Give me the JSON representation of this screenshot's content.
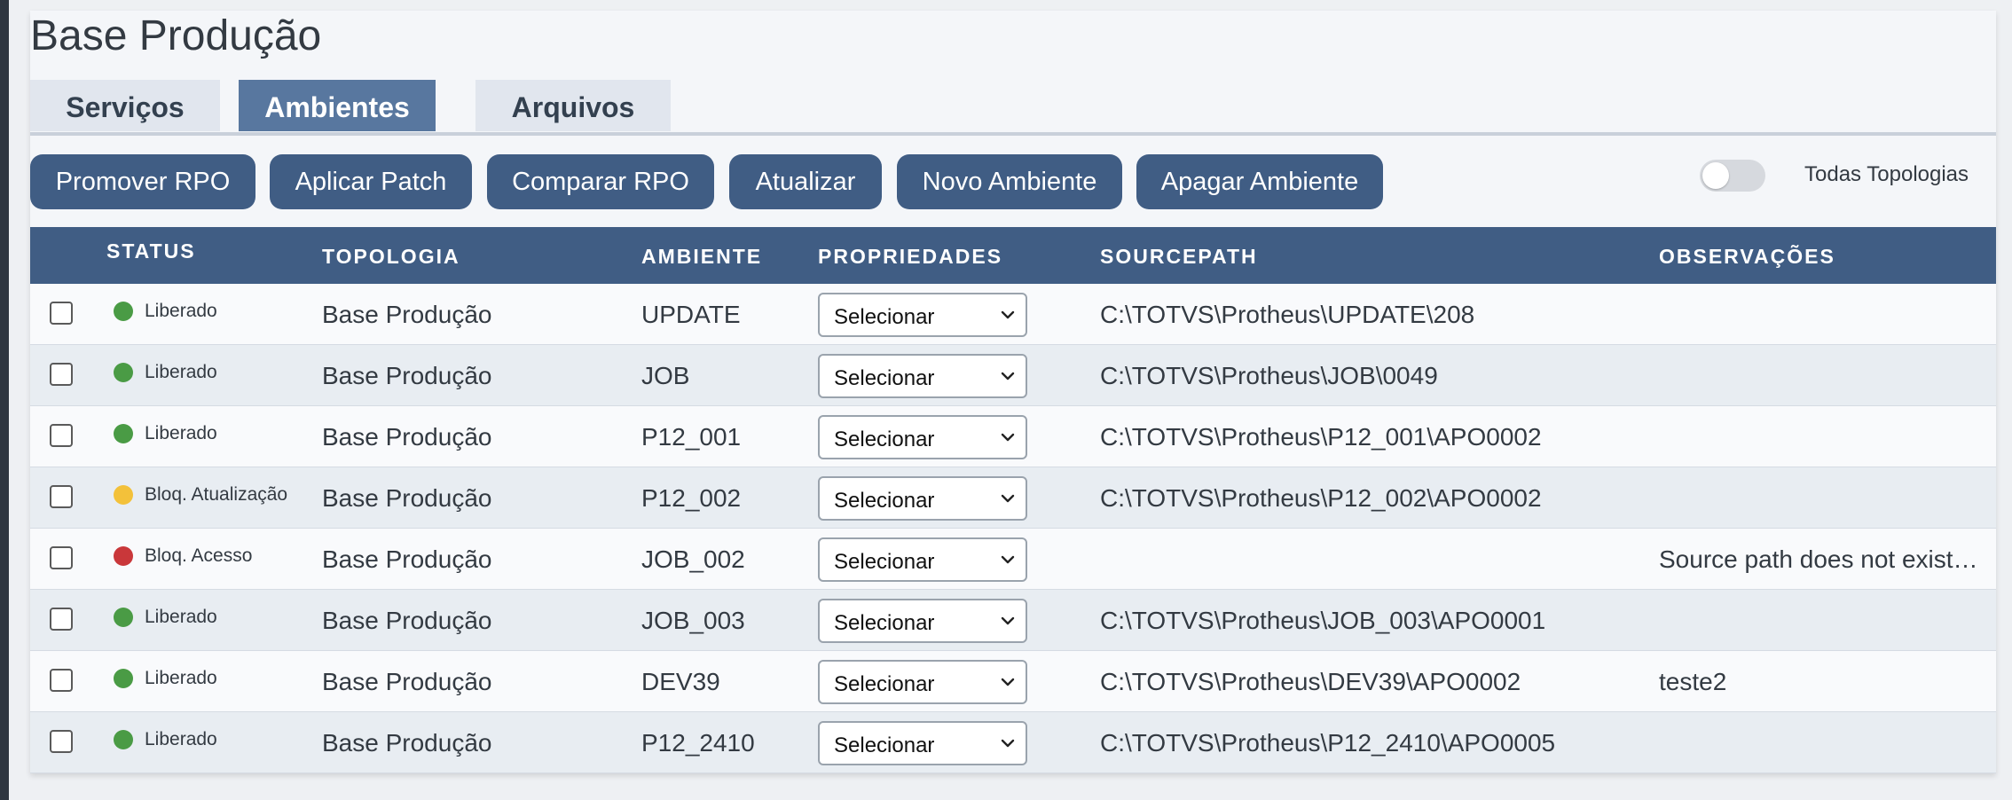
{
  "page": {
    "title": "Base Produção"
  },
  "tabs": [
    {
      "label": "Serviços",
      "active": false
    },
    {
      "label": "Ambientes",
      "active": true
    },
    {
      "label": "Arquivos",
      "active": false
    }
  ],
  "toolbar": {
    "buttons": [
      "Promover RPO",
      "Aplicar Patch",
      "Comparar RPO",
      "Atualizar",
      "Novo Ambiente",
      "Apagar Ambiente"
    ],
    "toggle_label": "Todas Topologias",
    "toggle_on": false
  },
  "table": {
    "headers": [
      "STATUS",
      "TOPOLOGIA",
      "AMBIENTE",
      "PROPRIEDADES",
      "SOURCEPATH",
      "OBSERVAÇÕES"
    ],
    "rows": [
      {
        "status": "Liberado",
        "status_color": "#4a9b45",
        "topologia": "Base Produção",
        "ambiente": "UPDATE",
        "propriedades": "Selecionar",
        "sourcepath": "C:\\TOTVS\\Protheus\\UPDATE\\208",
        "observacoes": ""
      },
      {
        "status": "Liberado",
        "status_color": "#4a9b45",
        "topologia": "Base Produção",
        "ambiente": "JOB",
        "propriedades": "Selecionar",
        "sourcepath": "C:\\TOTVS\\Protheus\\JOB\\0049",
        "observacoes": ""
      },
      {
        "status": "Liberado",
        "status_color": "#4a9b45",
        "topologia": "Base Produção",
        "ambiente": "P12_001",
        "propriedades": "Selecionar",
        "sourcepath": "C:\\TOTVS\\Protheus\\P12_001\\APO0002",
        "observacoes": ""
      },
      {
        "status": "Bloq. Atualização",
        "status_color": "#f3c13a",
        "topologia": "Base Produção",
        "ambiente": "P12_002",
        "propriedades": "Selecionar",
        "sourcepath": "C:\\TOTVS\\Protheus\\P12_002\\APO0002",
        "observacoes": ""
      },
      {
        "status": "Bloq. Acesso",
        "status_color": "#c9373a",
        "topologia": "Base Produção",
        "ambiente": "JOB_002",
        "propriedades": "Selecionar",
        "sourcepath": "",
        "observacoes": "Source path does not exist on disk"
      },
      {
        "status": "Liberado",
        "status_color": "#4a9b45",
        "topologia": "Base Produção",
        "ambiente": "JOB_003",
        "propriedades": "Selecionar",
        "sourcepath": "C:\\TOTVS\\Protheus\\JOB_003\\APO0001",
        "observacoes": ""
      },
      {
        "status": "Liberado",
        "status_color": "#4a9b45",
        "topologia": "Base Produção",
        "ambiente": "DEV39",
        "propriedades": "Selecionar",
        "sourcepath": "C:\\TOTVS\\Protheus\\DEV39\\APO0002",
        "observacoes": "teste2"
      },
      {
        "status": "Liberado",
        "status_color": "#4a9b45",
        "topologia": "Base Produção",
        "ambiente": "P12_2410",
        "propriedades": "Selecionar",
        "sourcepath": "C:\\TOTVS\\Protheus\\P12_2410\\APO0005",
        "observacoes": ""
      }
    ]
  }
}
